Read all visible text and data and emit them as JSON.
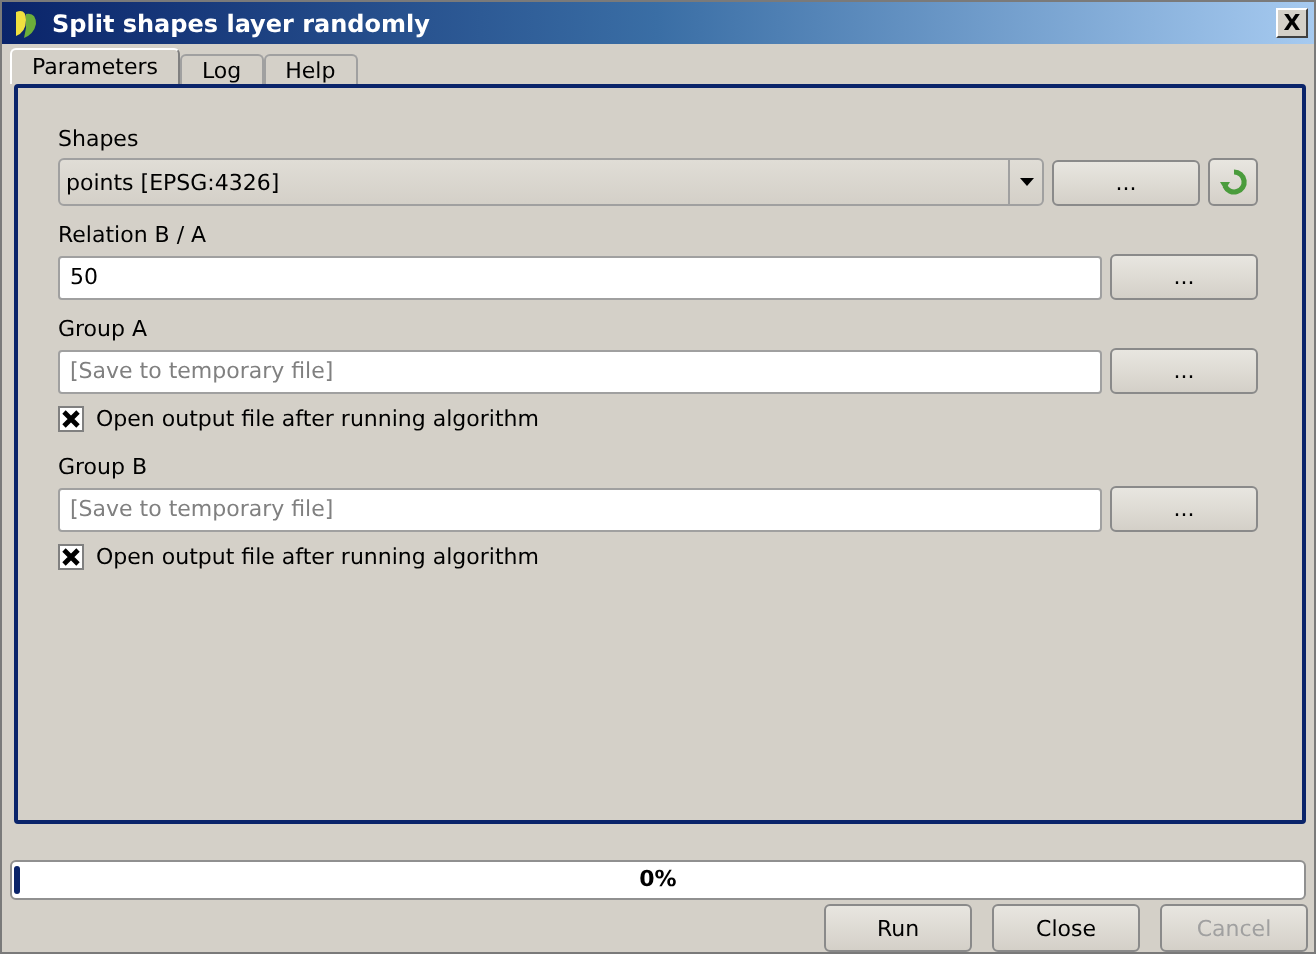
{
  "window": {
    "title": "Split shapes layer randomly",
    "close": "X"
  },
  "tabs": [
    {
      "label": "Parameters",
      "selected": true
    },
    {
      "label": "Log",
      "selected": false
    },
    {
      "label": "Help",
      "selected": false
    }
  ],
  "parameters": [
    {
      "kind": "combo",
      "label": "Shapes",
      "value": "points [EPSG:4326]",
      "button": "..."
    },
    {
      "kind": "text",
      "label": "Relation B / A",
      "value": "50",
      "button": "..."
    },
    {
      "kind": "output",
      "label": "Group A",
      "placeholder": "[Save to temporary file]",
      "button": "...",
      "checkbox": {
        "label": "Open output file after running algorithm",
        "checked": true
      }
    },
    {
      "kind": "output",
      "label": "Group B",
      "placeholder": "[Save to temporary file]",
      "button": "...",
      "checkbox": {
        "label": "Open output file after running algorithm",
        "checked": true
      }
    }
  ],
  "progress": {
    "level": 0,
    "reading": "0%"
  },
  "buttons": [
    {
      "label": "Run",
      "disabled": false
    },
    {
      "label": "Close",
      "disabled": false
    },
    {
      "label": "Cancel",
      "disabled": true
    }
  ]
}
